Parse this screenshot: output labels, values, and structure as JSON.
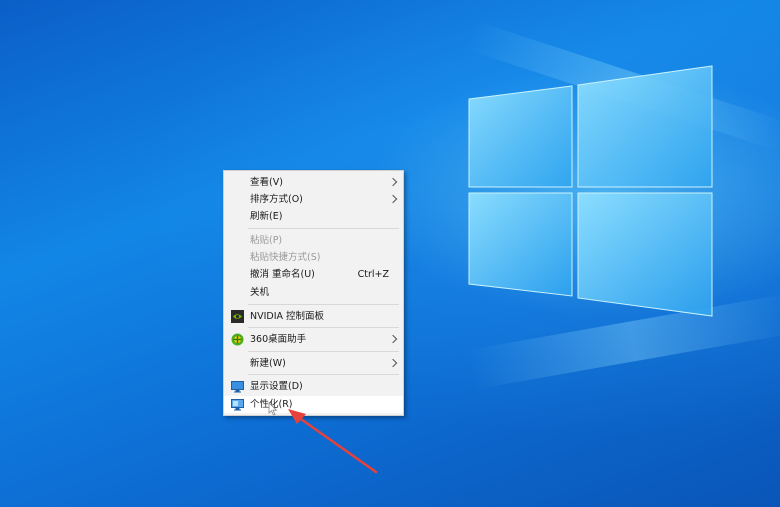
{
  "context_menu": {
    "items": [
      {
        "label": "查看(V)"
      },
      {
        "label": "排序方式(O)"
      },
      {
        "label": "刷新(E)"
      },
      {
        "label": "粘贴(P)"
      },
      {
        "label": "粘贴快捷方式(S)"
      },
      {
        "label": "撤消 重命名(U)",
        "shortcut": "Ctrl+Z"
      },
      {
        "label": "关机"
      },
      {
        "label": "NVIDIA 控制面板"
      },
      {
        "label": "360桌面助手"
      },
      {
        "label": "新建(W)"
      },
      {
        "label": "显示设置(D)"
      },
      {
        "label": "个性化(R)"
      }
    ]
  },
  "colors": {
    "desktop": "#1286e6",
    "menu_bg": "#f2f2f2",
    "highlight": "#ffffff",
    "annotation_arrow": "#e8413a"
  },
  "icons": {
    "nvidia": "nvidia-icon",
    "desk360": "360-icon",
    "display": "display-settings-icon",
    "personalize": "personalize-icon"
  }
}
